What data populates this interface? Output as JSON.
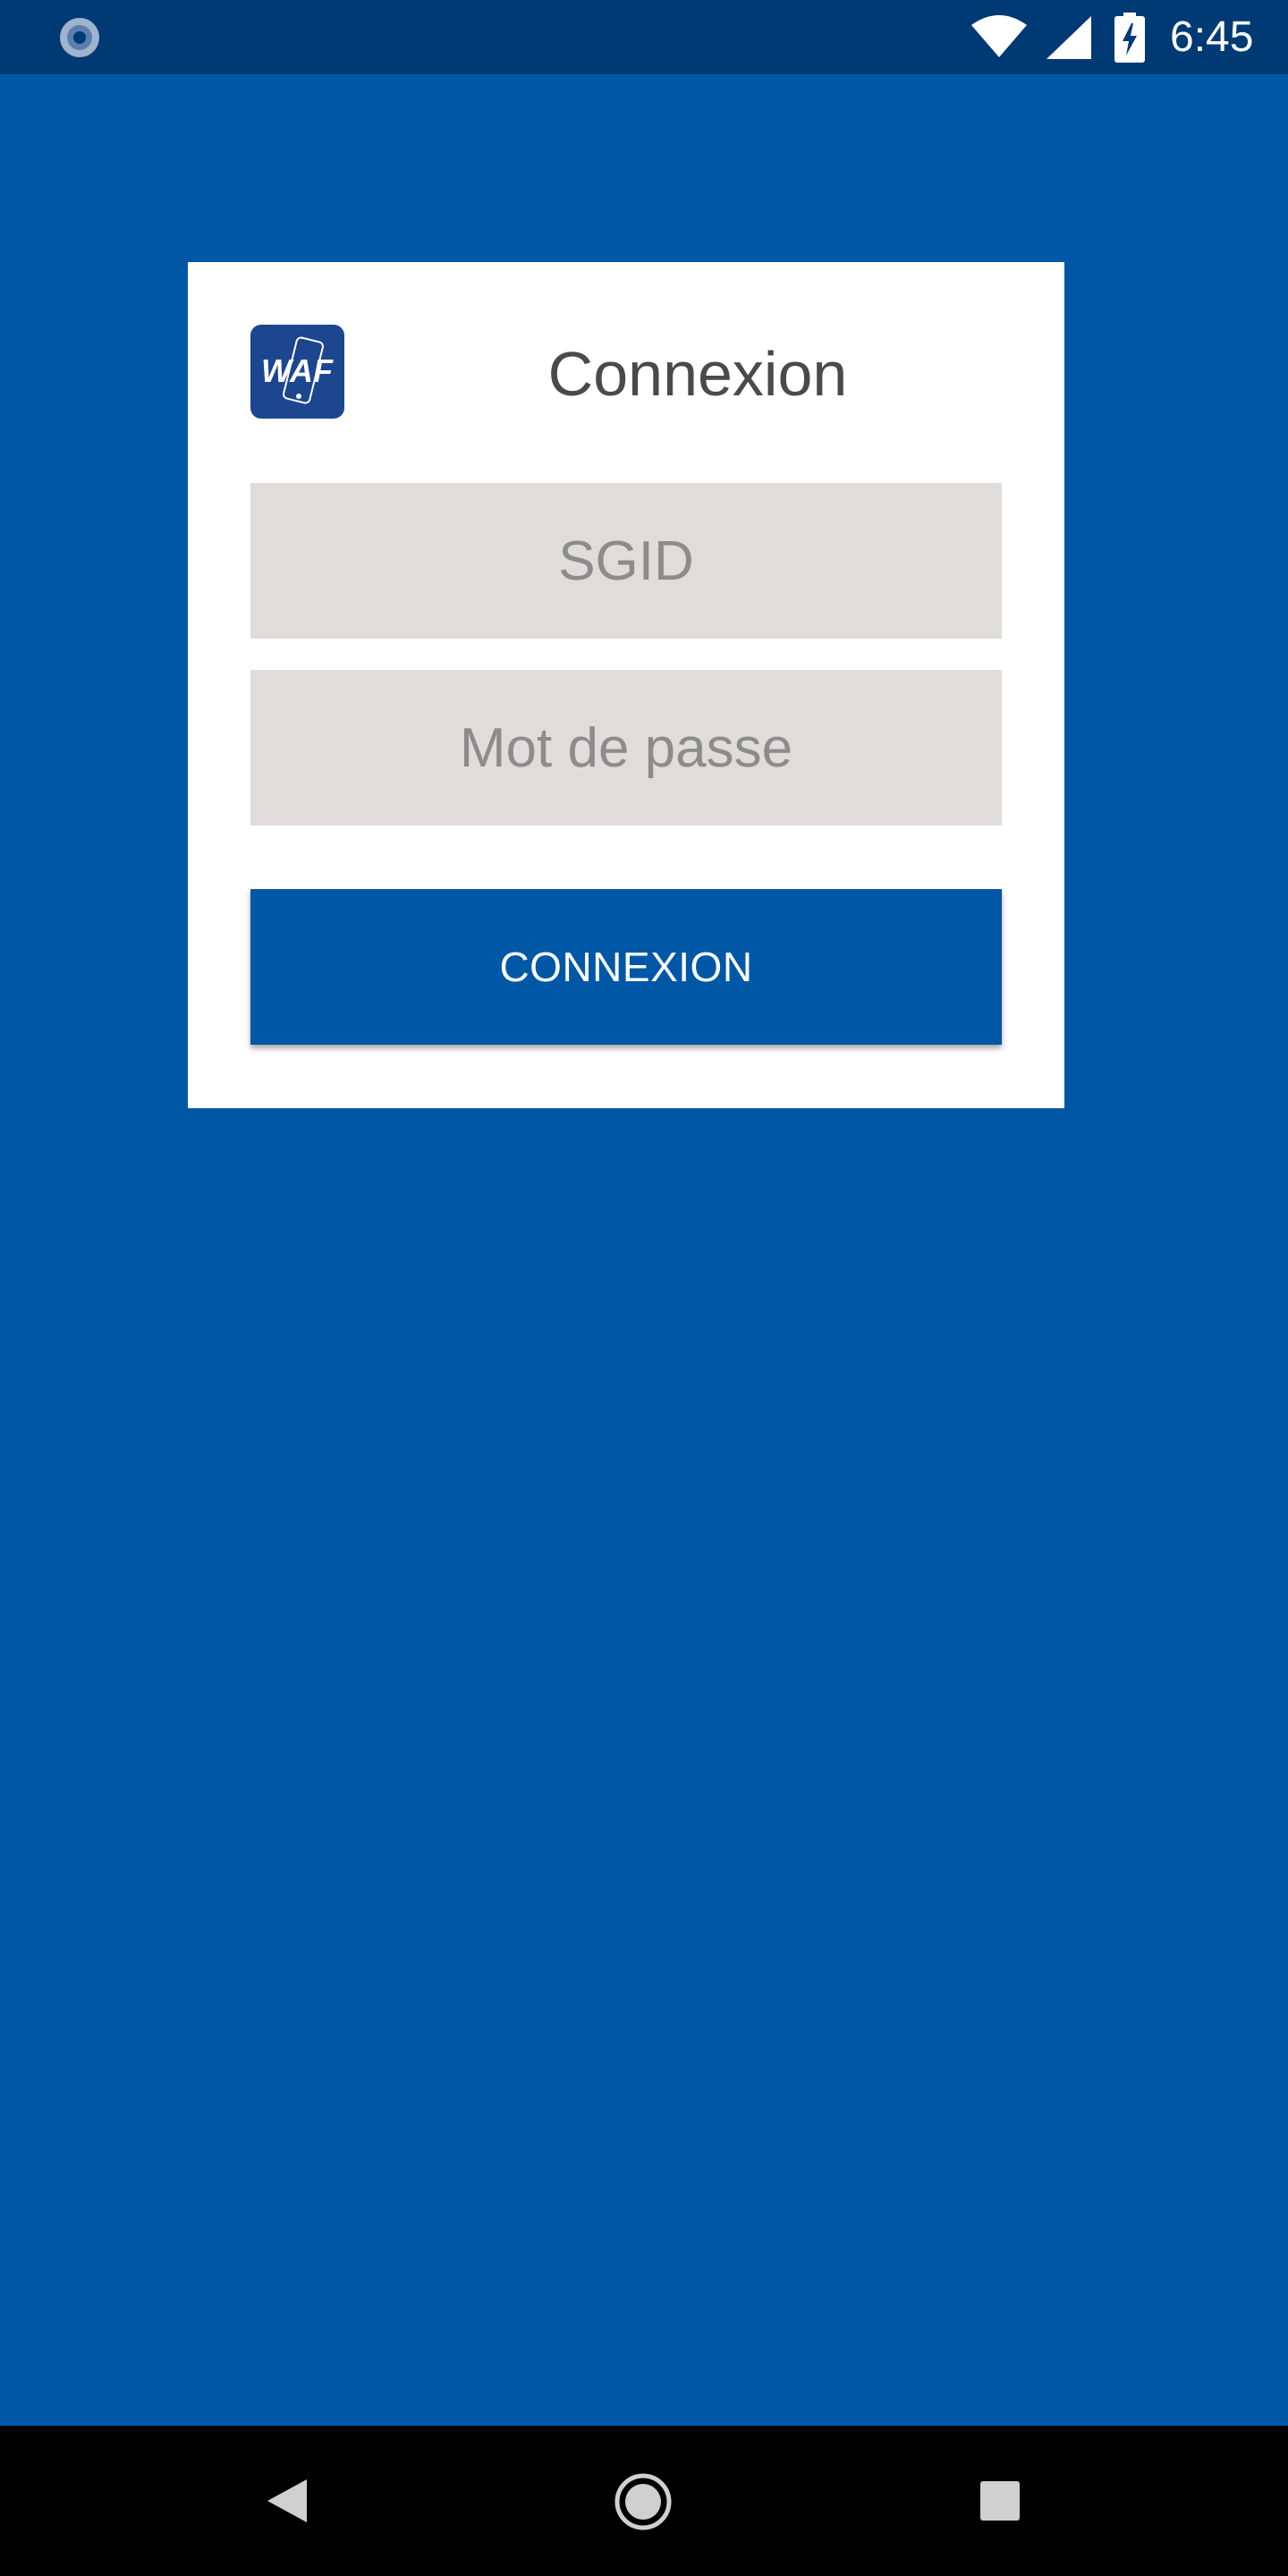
{
  "status_bar": {
    "time": "6:45",
    "left_icon": "sync-spinner-icon",
    "icons": [
      "wifi-icon",
      "signal-icon",
      "battery-charging-icon"
    ]
  },
  "login": {
    "logo_text": "WAF",
    "title": "Connexion",
    "sgid_placeholder": "SGID",
    "password_placeholder": "Mot de passe",
    "submit_label": "CONNEXION"
  },
  "nav_bar": {
    "icons": [
      "back-icon",
      "home-icon",
      "recents-icon"
    ]
  },
  "colors": {
    "background": "#0057a6",
    "status_bar": "#003a75",
    "card": "#ffffff",
    "input_bg": "#e0dcdc",
    "button": "#0057a6",
    "logo_bg": "#1c4690"
  }
}
